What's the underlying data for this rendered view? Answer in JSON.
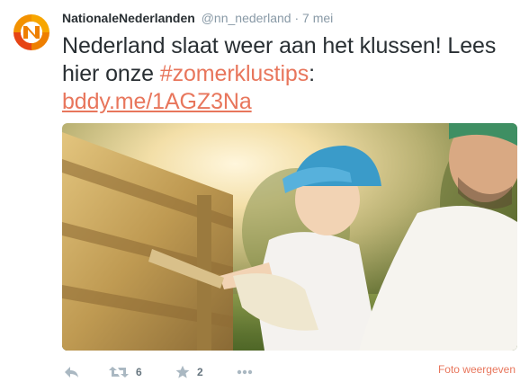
{
  "tweet": {
    "author_name": "NationaleNederlanden",
    "handle": "@nn_nederland",
    "separator": "·",
    "time": "7 mei",
    "text_before": "Nederland slaat weer aan het klussen! Lees hier onze ",
    "hashtag": "#zomerklustips",
    "text_after": ":",
    "link": "bddy.me/1AGZ3Na"
  },
  "actions": {
    "retweet_count": "6",
    "favorite_count": "2",
    "view_photo_label": "Foto weergeven"
  },
  "icons": {
    "avatar": "nn-logo-icon",
    "reply": "reply-icon",
    "retweet": "retweet-icon",
    "favorite": "star-icon",
    "more": "more-dots-icon"
  },
  "colors": {
    "accent": "#e8765c",
    "muted": "#8899a6",
    "text": "#292f33",
    "brand_orange": "#ee7f00"
  }
}
